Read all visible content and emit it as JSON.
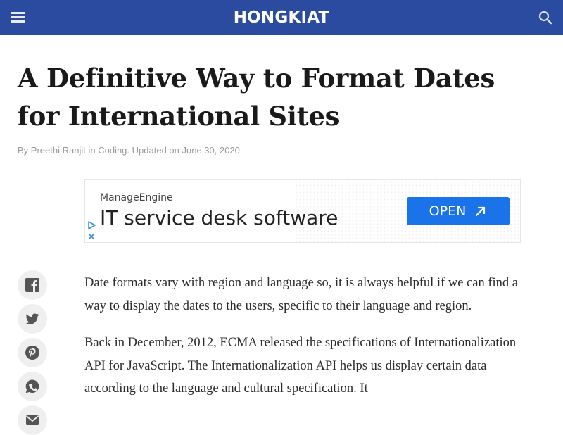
{
  "header": {
    "logo": "HONGKIAT",
    "background": "#2a4ba0",
    "menu_icon": "hamburger-menu-icon",
    "search_icon": "search-icon"
  },
  "article": {
    "title": "A Definitive Way to Format Dates for International Sites",
    "byline": {
      "prefix": "By",
      "author": "Preethi Ranjit",
      "in": "in",
      "category": "Coding.",
      "updated": "Updated on June 30, 2020."
    },
    "paragraphs": [
      "Date formats vary with region and language so, it is always helpful if we can find a way to display the dates to the users, specific to their language and region.",
      "Back in December, 2012, ECMA released the specifications of Internationalization API for JavaScript. The Internationalization API helps us display certain data according to the language and cultural specification. It"
    ]
  },
  "ad": {
    "brand": "ManageEngine",
    "headline": "IT service desk software",
    "cta": "OPEN",
    "cta_color": "#1a73e8",
    "info_icon": "ad-choices-icon",
    "close_icon": "close-icon"
  },
  "share": {
    "buttons": [
      {
        "name": "facebook",
        "icon": "facebook-icon"
      },
      {
        "name": "twitter",
        "icon": "twitter-icon"
      },
      {
        "name": "pinterest",
        "icon": "pinterest-icon"
      },
      {
        "name": "whatsapp",
        "icon": "whatsapp-icon"
      },
      {
        "name": "email",
        "icon": "email-icon"
      }
    ]
  }
}
